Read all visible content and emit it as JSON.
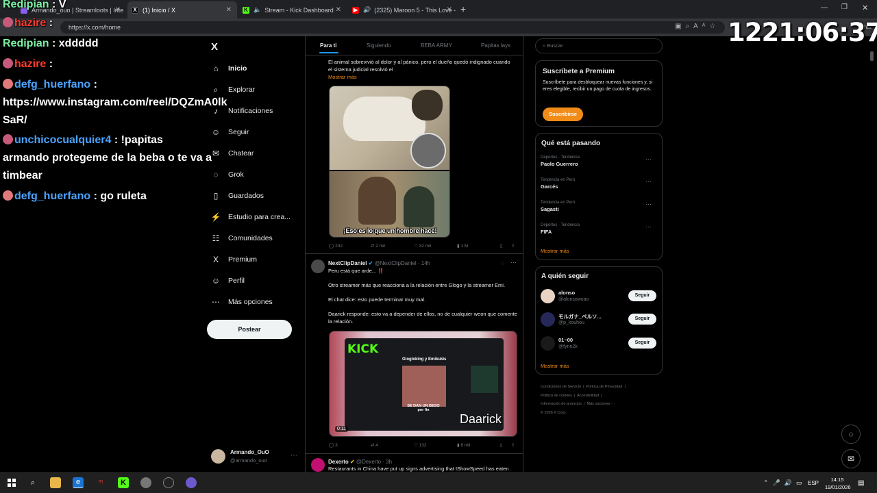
{
  "browser": {
    "tabs": [
      {
        "label": "Armando_ouo | Streamloots | Inte",
        "active": false
      },
      {
        "label": "(1) Inicio / X",
        "active": true
      },
      {
        "label": "Stream - Kick Dashboard",
        "active": false
      },
      {
        "label": "(2325) Maroon 5 - This Love -",
        "active": false
      }
    ],
    "url": "https://x.com/home",
    "chat_label": "Chat"
  },
  "timer": "1221:06:37",
  "chat_overlay": [
    {
      "user": "Redipian",
      "color": "#7cf2a5",
      "message": "V"
    },
    {
      "user": "hazire",
      "color": "#ff3b30",
      "message": ""
    },
    {
      "user": "Redipian",
      "color": "#7cf2a5",
      "message": "xddddd"
    },
    {
      "user": "hazire",
      "color": "#ff3b30",
      "message": ""
    },
    {
      "user": "defg_huerfano",
      "color": "#4aa3ff",
      "message": "",
      "line2": "https://www.instagram.com/reel/DQZmA0lk",
      "line3": "SaR/"
    },
    {
      "user": "unchicocualquier4",
      "color": "#4aa3ff",
      "message": "!papitas",
      "line2": "armando protegeme de la beba o te va a",
      "line3": "timbear"
    },
    {
      "user": "defg_huerfano",
      "color": "#4aa3ff",
      "message": "go ruleta"
    }
  ],
  "nav": {
    "items": [
      {
        "label": "Inicio",
        "icon": "home-icon",
        "glyph": "⌂"
      },
      {
        "label": "Explorar",
        "icon": "search-icon",
        "glyph": "⌕"
      },
      {
        "label": "Notificaciones",
        "icon": "bell-icon",
        "glyph": "♪"
      },
      {
        "label": "Seguir",
        "icon": "follow-icon",
        "glyph": "☺"
      },
      {
        "label": "Chatear",
        "icon": "mail-icon",
        "glyph": "✉"
      },
      {
        "label": "Grok",
        "icon": "grok-icon",
        "glyph": "◌"
      },
      {
        "label": "Guardados",
        "icon": "bookmark-icon",
        "glyph": "▯"
      },
      {
        "label": "Estudio para crea...",
        "icon": "studio-icon",
        "glyph": "⚡"
      },
      {
        "label": "Comunidades",
        "icon": "communities-icon",
        "glyph": "☷"
      },
      {
        "label": "Premium",
        "icon": "x-logo-icon",
        "glyph": "X"
      },
      {
        "label": "Perfil",
        "icon": "profile-icon",
        "glyph": "☺"
      },
      {
        "label": "Más opciones",
        "icon": "more-icon",
        "glyph": "⋯"
      }
    ],
    "post_button": "Postear",
    "account_name": "Armando_OuO",
    "account_handle": "@armando_ouo"
  },
  "feed": {
    "tabs": [
      "Para ti",
      "Siguiendo",
      "BEBA ARMY",
      "Papitas lays"
    ],
    "tweet1": {
      "text": "El animal sobrevivió al dolor y al pánico, pero el dueño quedó indignado cuando el sistema judicial resolvió el",
      "show_more": "Mostrar más",
      "caption": "¡Eso es lo que un hombre hace!",
      "stats": [
        "232",
        "2 mil",
        "32 mil",
        "1 M"
      ]
    },
    "tweet2": {
      "name": "NextClipDaniel",
      "handle": "@NextClipDaniel · 14h",
      "line1": "Peru está que arde... ‼️",
      "line2": "Otro streamer más que reacciona a la relación entre Glogo y la streamer Emi.",
      "line3": "El chat dice: esto puede terminar muy mal.",
      "line4": "Daarick responde: esto va a depender de ellos, no de cualquier weon que comente la relación.",
      "media_title": "Glogloking y Emikukis",
      "media_caption": "SE DAN UN BESO por fin",
      "media_watermark": "Daarick",
      "media_time": "0:11",
      "stats": [
        "3",
        "4",
        "132",
        "8 mil"
      ]
    },
    "tweet3": {
      "name": "Dexerto",
      "handle": "@Dexerto · 3h",
      "text": "Restaurants in China have put up signs advertising that IShowSpeed has eaten"
    }
  },
  "sidebar": {
    "search_placeholder": "Buscar",
    "premium": {
      "title": "Suscríbete a Premium",
      "text": "Suscríbete para desbloquear nuevas funciones y, si eres elegible, recibir un pago de cuota de ingresos.",
      "button": "Suscribirse"
    },
    "trends_title": "Qué está pasando",
    "trends": [
      {
        "category": "Deportes · Tendencia",
        "name": "Paolo Guerrero"
      },
      {
        "category": "Tendencia en Perú",
        "name": "Garcés"
      },
      {
        "category": "Tendencia en Perú",
        "name": "Sagasti"
      },
      {
        "category": "Deportes · Tendencia",
        "name": "FIFA"
      }
    ],
    "show_more": "Mostrar más",
    "follow_title": "A quién seguir",
    "follow": [
      {
        "name": "alonso",
        "handle": "@alonsowuao"
      },
      {
        "name": "モルガナ_ペルソ...",
        "handle": "@p_kouhou"
      },
      {
        "name": "01~00",
        "handle": "@fynn2k"
      }
    ],
    "follow_button": "Seguir",
    "footer": [
      "Condiciones de Servicio",
      "Política de Privacidad",
      "Política de cookies",
      "Accesibilidad",
      "Información de anuncios",
      "Más opciones ···",
      "© 2026 X Corp."
    ]
  },
  "taskbar": {
    "lang": "ESP",
    "time": "14:15",
    "date": "19/01/2026"
  },
  "colors": {
    "accent": "#1d9bf0",
    "premium_button": "#f28c18",
    "link": "#f28c18"
  }
}
